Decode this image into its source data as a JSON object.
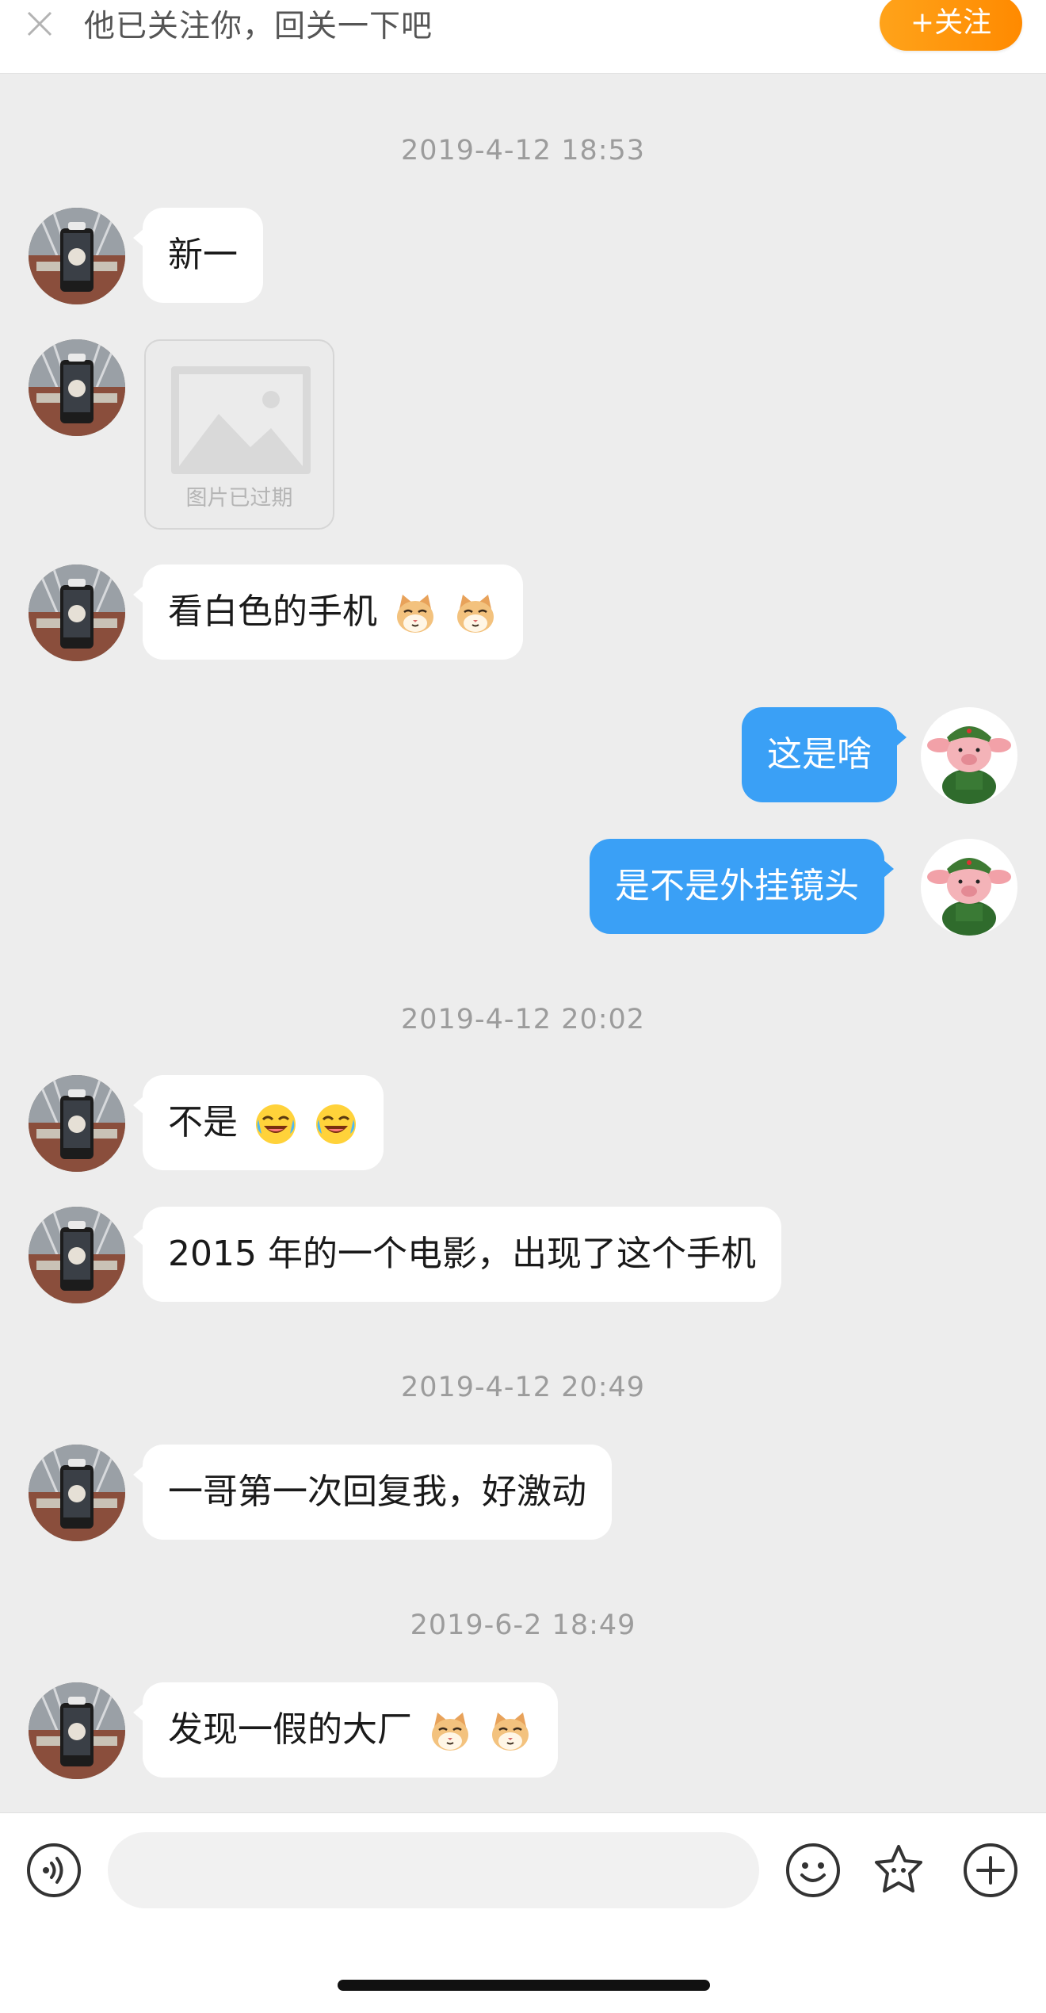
{
  "follow_banner": {
    "text": "他已关注你，回关一下吧",
    "button_label": "+关注",
    "button_color": "#ff9500"
  },
  "messages": {
    "ts1": "2019-4-12 18:53",
    "m1": "新一",
    "img_expired": "图片已过期",
    "m3": "看白色的手机",
    "m4": "这是啥",
    "m5": "是不是外挂镜头",
    "ts2": "2019-4-12 20:02",
    "m6": "不是",
    "m7": "2015 年的一个电影，出现了这个手机",
    "ts3": "2019-4-12 20:49",
    "m8": "一哥第一次回复我，好激动",
    "ts4": "2019-6-2 18:49",
    "m9": "发现一假的大厂"
  },
  "input_bar": {
    "placeholder": "",
    "icons": [
      "voice-icon",
      "smiley-icon",
      "star-sticker-icon",
      "plus-icon"
    ]
  },
  "colors": {
    "outgoing_bubble": "#3aa0f6",
    "incoming_bubble": "#ffffff",
    "background": "#ededed"
  }
}
